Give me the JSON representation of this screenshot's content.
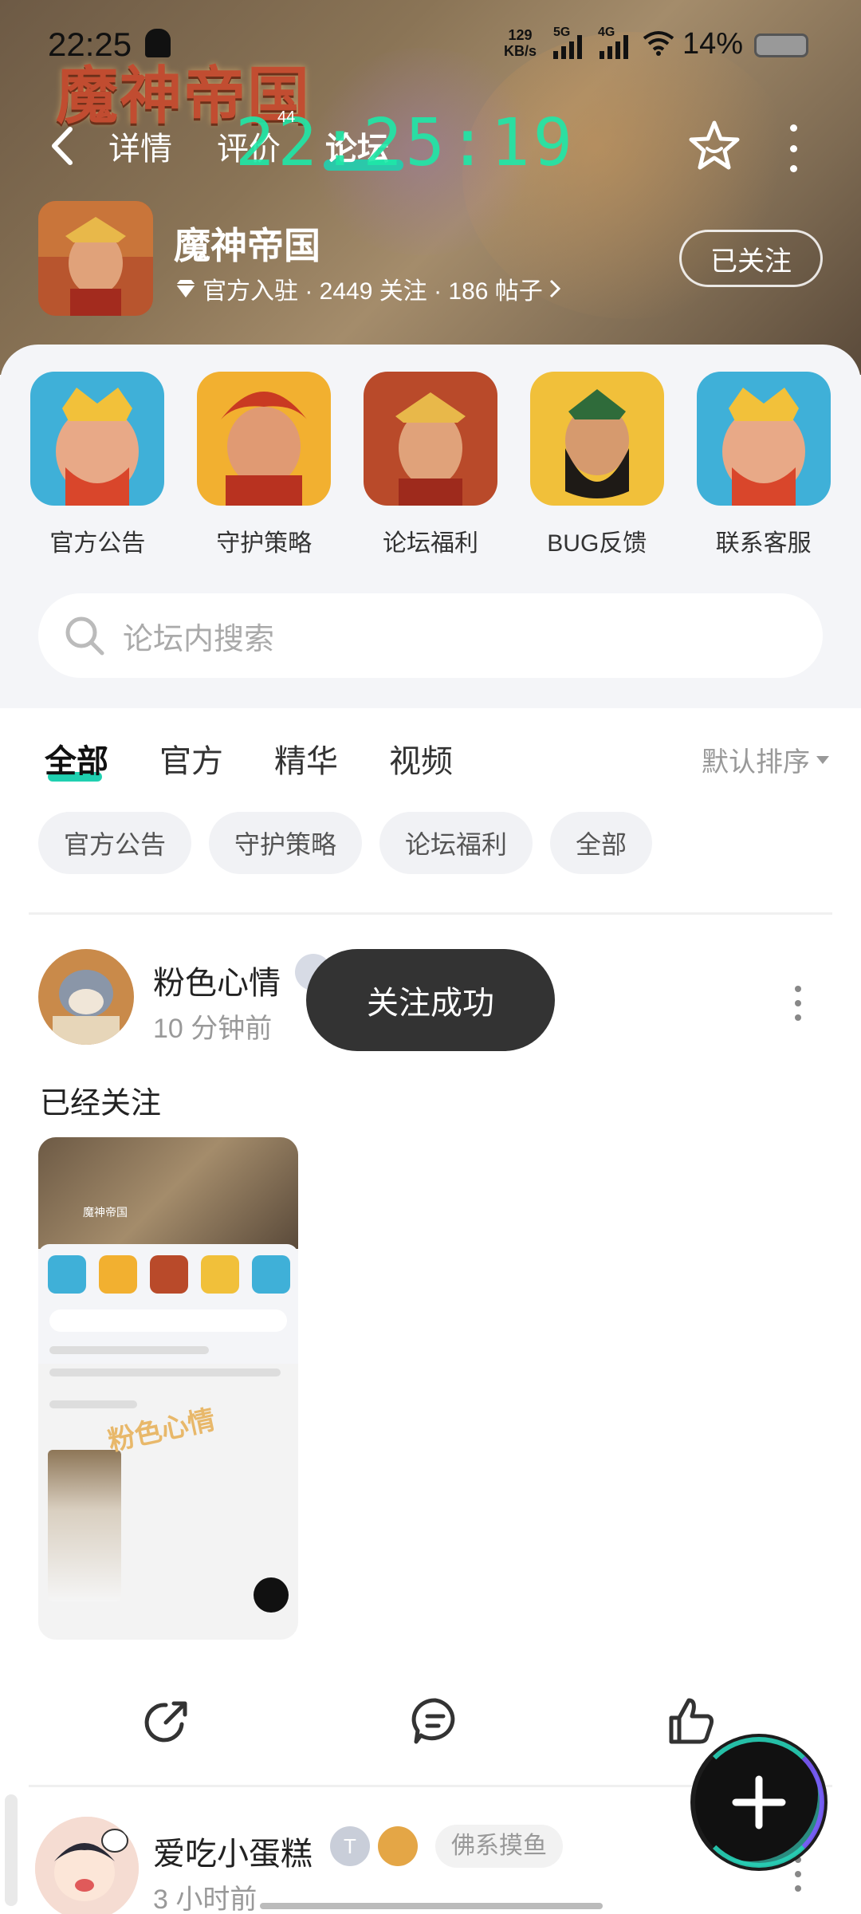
{
  "status_bar": {
    "time": "22:25",
    "net_speed_value": "129",
    "net_speed_unit": "KB/s",
    "sig1_label": "5G",
    "sig2_label": "4G",
    "battery": "14%"
  },
  "nav": {
    "tabs": [
      "详情",
      "评价",
      "论坛"
    ],
    "active_tab": "论坛",
    "overlay_clock": "22:25:19",
    "overlay_small": "44"
  },
  "forum": {
    "banner_logo": "魔神帝国",
    "name": "魔神帝国",
    "meta": "官方入驻 · 2449 关注 · 186 帖子",
    "follow_label": "已关注"
  },
  "shortcuts": [
    {
      "label": "官方公告"
    },
    {
      "label": "守护策略"
    },
    {
      "label": "论坛福利"
    },
    {
      "label": "BUG反馈"
    },
    {
      "label": "联系客服"
    }
  ],
  "search": {
    "placeholder": "论坛内搜索"
  },
  "filter_tabs": {
    "items": [
      "全部",
      "官方",
      "精华",
      "视频"
    ],
    "sort_label": "默认排序"
  },
  "chips": [
    "官方公告",
    "守护策略",
    "论坛福利",
    "全部"
  ],
  "post1": {
    "author": "粉色心情",
    "time": "10 分钟前",
    "text": "已经关注",
    "thumb_watermark": "粉色心情",
    "thumb_title": "魔神帝国"
  },
  "toast": "关注成功",
  "post2": {
    "author": "爱吃小蛋糕",
    "badge_level": "T",
    "tag": "佛系摸鱼",
    "time": "3 小时前"
  },
  "colors": {
    "accent": "#1fd0b0",
    "toast_bg": "#333333",
    "panel_bg": "#f4f5f8"
  }
}
